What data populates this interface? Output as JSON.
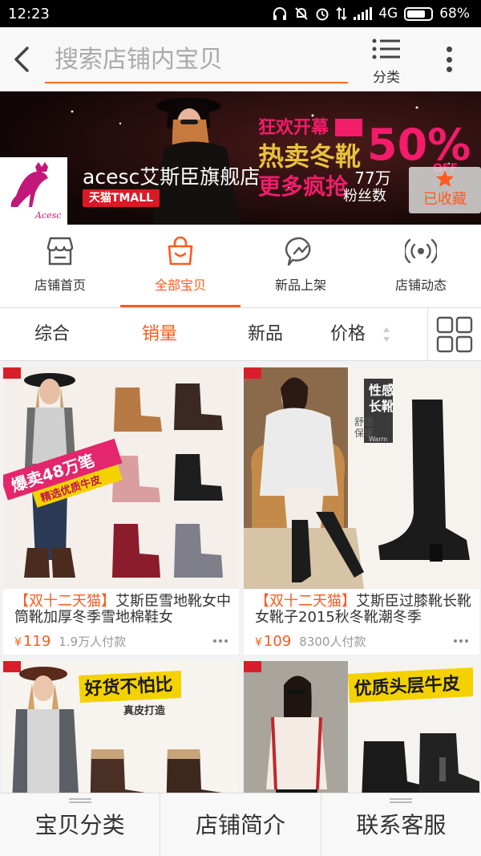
{
  "status_bar": {
    "time": "12:23",
    "network": "4G",
    "battery": "68%"
  },
  "search": {
    "placeholder": "搜索店铺内宝贝",
    "category_label": "分类"
  },
  "shop": {
    "name": "acesc艾斯臣旗舰店",
    "badge": "天猫TMALL",
    "fans_count": "77万",
    "fans_label": "粉丝数",
    "favorite_label": "已收藏",
    "logo_text": "Acesc",
    "banner_text_1": "狂欢开幕",
    "banner_text_2": "热卖冬靴",
    "banner_text_3": "更多疯抢",
    "banner_text_4": "50%",
    "banner_text_5": "OFF"
  },
  "shop_tabs": [
    {
      "label": "店铺首页",
      "icon": "store-icon",
      "active": false
    },
    {
      "label": "全部宝贝",
      "icon": "shopping-bag-icon",
      "active": true
    },
    {
      "label": "新品上架",
      "icon": "new-items-icon",
      "active": false
    },
    {
      "label": "店铺动态",
      "icon": "broadcast-icon",
      "active": false
    }
  ],
  "sort_bar": {
    "items": [
      {
        "label": "综合",
        "active": false
      },
      {
        "label": "销量",
        "active": true
      },
      {
        "label": "新品",
        "active": false
      },
      {
        "label": "价格",
        "active": false
      }
    ]
  },
  "products": [
    {
      "tag": "【双十二天猫】",
      "title": "艾斯臣雪地靴女中筒靴加厚冬季雪地棉鞋女",
      "price": "119",
      "sales": "1.9万人付款",
      "image_text": "爆卖48万笔",
      "image_subtext": "精选优质牛皮"
    },
    {
      "tag": "【双十二天猫】",
      "title": "艾斯臣过膝靴长靴女靴子2015秋冬靴潮冬季",
      "price": "109",
      "sales": "8300人付款",
      "image_text": "性感长靴",
      "image_subtext": "舒适保暖",
      "image_small": "Warm"
    },
    {
      "image_text": "好货不怕比",
      "image_subtext": "真皮打造"
    },
    {
      "image_text": "优质头层牛皮"
    }
  ],
  "currency_symbol": "¥",
  "bottom_bar": [
    {
      "label": "宝贝分类"
    },
    {
      "label": "店铺简介"
    },
    {
      "label": "联系客服"
    }
  ],
  "colors": {
    "accent": "#ff5a1f",
    "tmall_red": "#d91a25"
  }
}
